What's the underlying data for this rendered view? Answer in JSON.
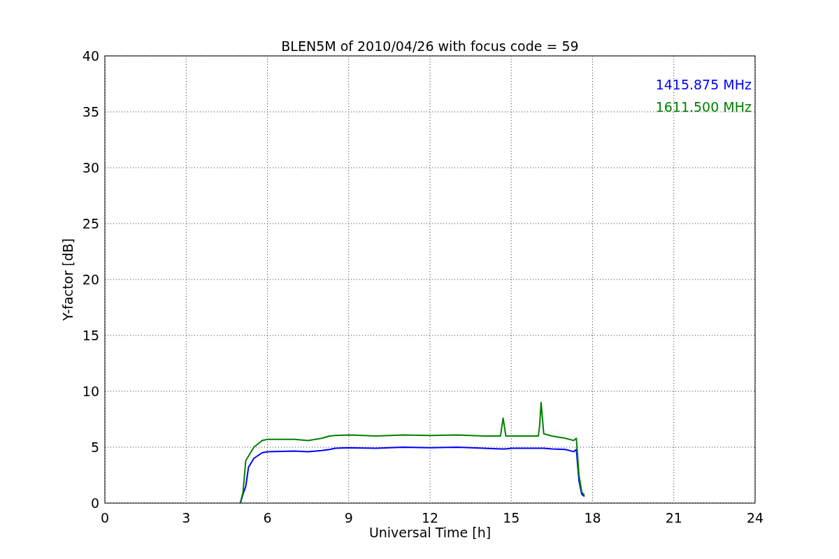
{
  "chart_data": {
    "type": "line",
    "title": "BLEN5M of 2010/04/26 with focus code = 59",
    "xlabel": "Universal Time [h]",
    "ylabel": "Y-factor [dB]",
    "x": [
      5.0,
      5.1,
      5.2,
      5.3,
      5.5,
      5.8,
      6,
      7,
      7.5,
      8,
      8.3,
      8.5,
      9,
      10,
      11,
      12,
      13,
      14,
      14.6,
      14.7,
      14.8,
      15,
      16,
      16.05,
      16.1,
      16.2,
      16.5,
      17,
      17.3,
      17.4,
      17.5,
      17.6,
      17.7
    ],
    "series": [
      {
        "name": "1415.875 MHz",
        "color": "#0000ff",
        "values": [
          0,
          0.8,
          1.5,
          3.2,
          4.0,
          4.5,
          4.6,
          4.65,
          4.6,
          4.7,
          4.8,
          4.9,
          4.95,
          4.9,
          5.0,
          4.95,
          5.0,
          4.9,
          4.85,
          4.85,
          4.85,
          4.9,
          4.9,
          4.9,
          4.9,
          4.9,
          4.85,
          4.8,
          4.6,
          4.8,
          2,
          0.8,
          0.6
        ]
      },
      {
        "name": "1611.500 MHz",
        "color": "#008000",
        "values": [
          0,
          1,
          3.8,
          4.2,
          5.0,
          5.6,
          5.7,
          5.7,
          5.6,
          5.8,
          6.0,
          6.05,
          6.1,
          6.0,
          6.1,
          6.05,
          6.1,
          6.0,
          6.0,
          7.6,
          6.0,
          6.0,
          6.0,
          7.0,
          9.0,
          6.2,
          6.0,
          5.8,
          5.6,
          5.8,
          2.5,
          1.0,
          0.7
        ]
      }
    ],
    "grid": true,
    "xlim": [
      0,
      24
    ],
    "ylim": [
      0,
      40
    ],
    "xticks": [
      0,
      3,
      6,
      9,
      12,
      15,
      18,
      21,
      24
    ],
    "yticks": [
      0,
      5,
      10,
      15,
      20,
      25,
      30,
      35,
      40
    ]
  }
}
